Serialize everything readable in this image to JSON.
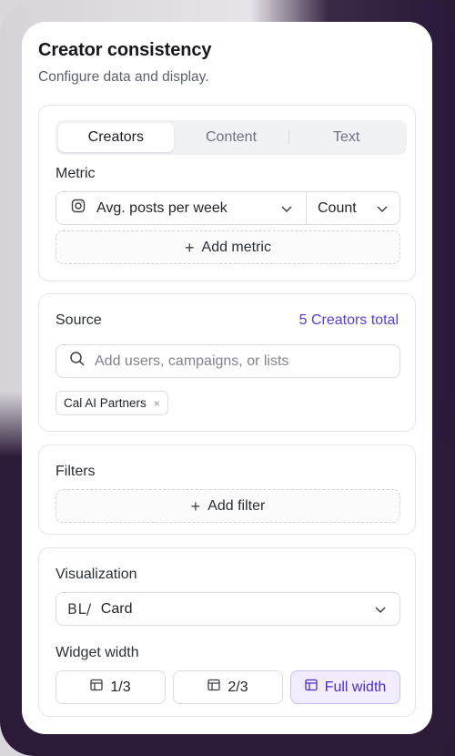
{
  "header": {
    "title": "Creator consistency",
    "subtitle": "Configure data and display."
  },
  "tabs": [
    {
      "label": "Creators",
      "active": true
    },
    {
      "label": "Content",
      "active": false
    },
    {
      "label": "Text",
      "active": false
    }
  ],
  "metric": {
    "label": "Metric",
    "icon": "instagram-icon",
    "value": "Avg. posts per week",
    "aggregation": "Count",
    "add_label": "Add metric"
  },
  "source": {
    "label": "Source",
    "total": "5 Creators total",
    "search_placeholder": "Add users, campaigns, or lists",
    "chips": [
      {
        "label": "Cal AI Partners",
        "remove": "×"
      }
    ]
  },
  "filters": {
    "label": "Filters",
    "add_label": "Add filter"
  },
  "visualization": {
    "label": "Visualization",
    "icon_text": "BL/",
    "value": "Card",
    "width_label": "Widget width",
    "widths": [
      {
        "label": "1/3",
        "active": false
      },
      {
        "label": "2/3",
        "active": false
      },
      {
        "label": "Full width",
        "active": true
      }
    ]
  },
  "colors": {
    "accent": "#5b3bd6",
    "active_bg": "#f1edff"
  }
}
